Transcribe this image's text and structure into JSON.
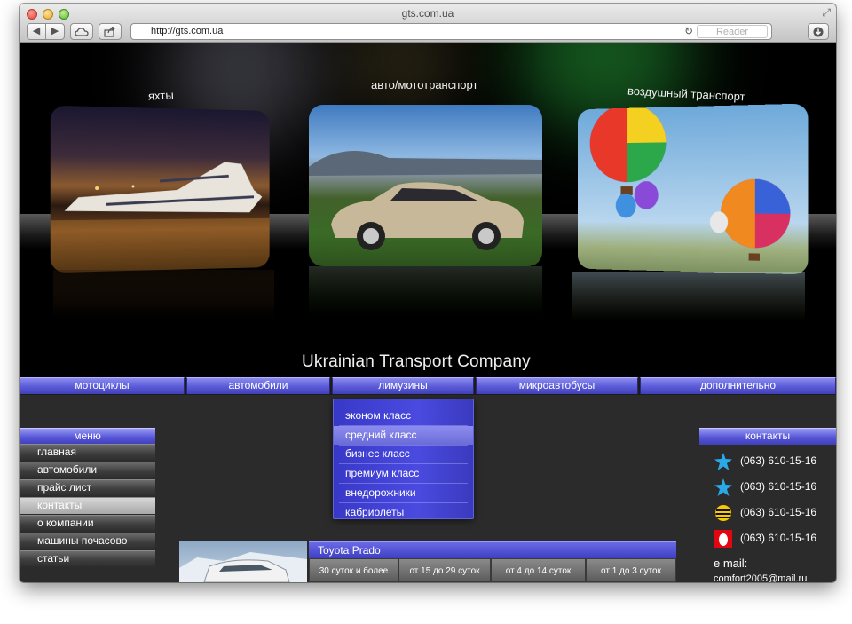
{
  "window": {
    "title": "gts.com.ua"
  },
  "toolbar": {
    "back": "◀",
    "forward": "▶",
    "url": "http://gts.com.ua",
    "reader": "Reader",
    "reload": "↻"
  },
  "hero": {
    "cards": [
      {
        "label": "яхты"
      },
      {
        "label": "авто/мототранспорт"
      },
      {
        "label": "воздушный транспорт"
      }
    ],
    "company": "Ukrainian Transport Company"
  },
  "topnav": [
    "мотоциклы",
    "автомобили",
    "лимузины",
    "микроавтобусы",
    "дополнительно"
  ],
  "dropdown": [
    "эконом класс",
    "средний класс",
    "бизнес класс",
    "премиум класс",
    "внедорожники",
    "кабриолеты"
  ],
  "leftmenu": {
    "title": "меню",
    "items": [
      "главная",
      "автомобили",
      "прайс лист",
      "контакты",
      "о компании",
      "машины почасово",
      "статьи"
    ]
  },
  "contacts": {
    "title": "контакты",
    "phones": [
      {
        "number": "(063) 610-15-16",
        "icon": "kyivstar-star-icon"
      },
      {
        "number": "(063) 610-15-16",
        "icon": "kyivstar-star-icon"
      },
      {
        "number": "(063) 610-15-16",
        "icon": "beeline-icon"
      },
      {
        "number": "(063) 610-15-16",
        "icon": "mts-egg-icon"
      }
    ],
    "email_label": "e mail:",
    "email": "comfort2005@mail.ru"
  },
  "product": {
    "title": "Toyota Prado",
    "price_columns": [
      "30 суток и более",
      "от 15 до 29 суток",
      "от 4 до 14 суток",
      "от 1 до 3 суток"
    ]
  },
  "colors": {
    "accent": "#5555d8",
    "hero_bg": "#000000",
    "page_bg": "#2b2b2b"
  }
}
